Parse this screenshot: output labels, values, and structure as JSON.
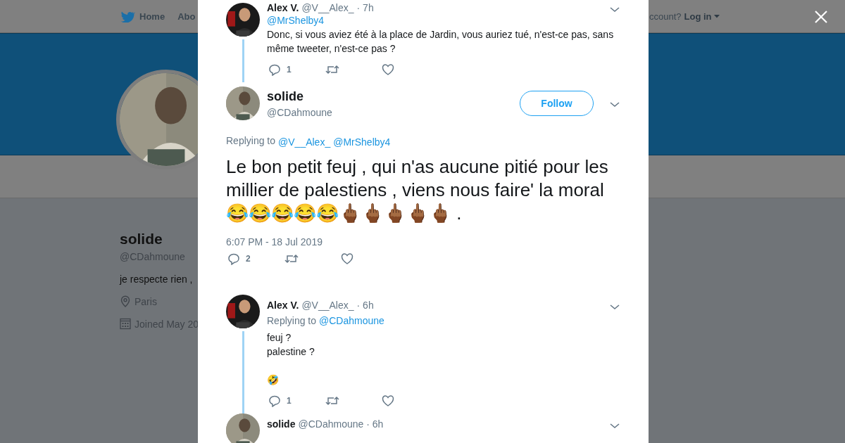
{
  "background_page": {
    "nav": {
      "items": [
        {
          "label": "Home"
        },
        {
          "label": "Abo"
        }
      ],
      "account_prompt": "ccount?",
      "login": "Log in"
    },
    "profile": {
      "name": "solide",
      "handle": "@CDahmoune",
      "bio": "je respecte rien ,",
      "location": "Paris",
      "joined": "Joined May 20"
    }
  },
  "modal": {
    "tweets": [
      {
        "kind": "reply",
        "name": "Alex V.",
        "handle": "@V__Alex_",
        "time": "· 7h",
        "mention": "@MrShelby4",
        "paragraphs": [
          "Donc, si vous aviez été à la place de Jardin, vous auriez tué, n'est-ce pas, sans même tweeter, n'est-ce pas ?"
        ],
        "reply_count": "1",
        "thread_line": true
      },
      {
        "kind": "main",
        "name": "solide",
        "handle": "@CDahmoune",
        "follow": "Follow",
        "replying_label": "Replying to",
        "replying_to": [
          "@V__Alex_",
          "@MrShelby4"
        ],
        "text": "Le bon petit feuj , qui n'as aucune pitié pour les millier de palestiens , viens nous faire' la moral 😂😂😂😂😂🖕🏾🖕🏾🖕🏾🖕🏾🖕🏾 .",
        "timestamp": "6:07 PM - 18 Jul 2019",
        "reply_count": "2"
      },
      {
        "kind": "reply",
        "name": "Alex V.",
        "handle": "@V__Alex_",
        "time": "· 6h",
        "replying_label": "Replying to",
        "replying_to": [
          "@CDahmoune"
        ],
        "paragraphs": [
          "feuj ?\npalestine ?",
          "🤣"
        ],
        "reply_count": "1",
        "thread_line": true
      },
      {
        "kind": "reply",
        "name": "solide",
        "handle": "@CDahmoune",
        "time": "· 6h"
      }
    ]
  }
}
